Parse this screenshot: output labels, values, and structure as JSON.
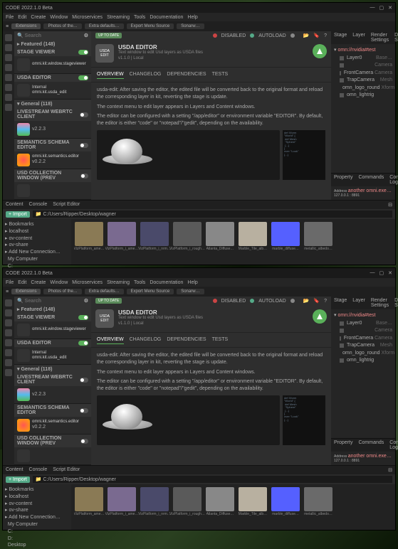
{
  "app_title": "CODE 2022.1.0 Beta",
  "menu": [
    "File",
    "Edit",
    "Create",
    "Window",
    "Microservices",
    "Streaming",
    "Tools",
    "Documentation",
    "Help"
  ],
  "tabs": [
    {
      "label": "Extensions",
      "active": true
    },
    {
      "label": "Photos of the…"
    },
    {
      "label": "Extra defaults…"
    },
    {
      "label": "Export Menu Source"
    },
    {
      "label": "Sonarw…"
    }
  ],
  "sidebar": {
    "search_ph": "Search",
    "featured": "Featured (148)",
    "items": [
      {
        "name": "STAGE VIEWER",
        "desc": "omni.kit.window.stageviewer",
        "ver": "",
        "color": "#333",
        "on": true
      },
      {
        "name": "USDA EDITOR",
        "desc": "Internal\nomni.kit.usda_edit",
        "ver": "",
        "color": "#333",
        "on": true
      },
      {
        "name": "General (118)",
        "desc": "",
        "ver": "",
        "hdr": true
      },
      {
        "name": "LIVESTREAM WEBRTC CLIENT",
        "desc": "",
        "ver": "v2.2.3",
        "color": "linear-gradient(#e8a,#5be,#5b5)",
        "on": false
      },
      {
        "name": "SEMANTICS SCHEMA EDITOR",
        "desc": "omni.kit.semantics.editor",
        "ver": "v0.2.2",
        "color": "radial-gradient(#f55,#fa0)",
        "on": false
      },
      {
        "name": "USD COLLECTION WINDOW (PREV",
        "desc": "",
        "ver": "",
        "color": "#333",
        "on": false
      }
    ]
  },
  "detail": {
    "badge": "UP TO DATE",
    "icon_label": "USDA\nEDIT",
    "title": "USDA EDITOR",
    "subtitle": "Text window to edit Usd layers as USDA files",
    "version": "v1.1.0  |  Local",
    "toolbar": [
      {
        "label": "DISABLED",
        "color": "#c44"
      },
      {
        "label": "AUTOLOAD",
        "color": "#5a8"
      },
      {
        "label": "",
        "color": "#888"
      }
    ],
    "tabs": [
      "OVERVIEW",
      "CHANGELOG",
      "DEPENDENCIES",
      "TESTS"
    ],
    "body": [
      "usda-edit: After saving the editor, the edited file will be converted back to the original format and reload the corresponding layer in kit, reverting the stage is update.",
      "The context menu to edit layer appears in Layers and Content windows.",
      "The editor can be configured with a setting \"/app/editor\" or environment variable \"EDITOR\". By default, the editor is either \"code\" or \"notepad\"/\"gedit\", depending on the availability."
    ]
  },
  "stage": {
    "tabs": [
      "Stage",
      "Layer",
      "Render Settings",
      "Debug Settings"
    ],
    "root": "omn://nvidia#test",
    "items": [
      "Layer0",
      "",
      "FrontCamera",
      "TrapCamera",
      "omn_logo_round",
      "omn_lightrig"
    ],
    "extra": [
      "Base…",
      "Camera",
      "Camera",
      "Mesh",
      "Xform"
    ],
    "props_tabs": [
      "Property",
      "Commands",
      "Console Log"
    ],
    "addr_label": "Address",
    "addr": "127.0.0.1 : 8891",
    "addr_warn": "another omni.exe…"
  },
  "browser": {
    "tabs": [
      "Content",
      "Console",
      "Script Editor"
    ],
    "path": "C:/Users/Ripper/Desktop/wagner",
    "tree": [
      "Bookmarks",
      "localhost",
      "ov-content",
      "ov-share",
      "Add New Connection…",
      "My Computer",
      "C:",
      "D:",
      "Desktop"
    ],
    "thumbs": [
      {
        "label": "VizPlatform_ame…",
        "bg": "#8a7a55"
      },
      {
        "label": "VizPlatform_i_ame…",
        "bg": "#7a6a90"
      },
      {
        "label": "VizPlatform_i_nrm…",
        "bg": "#4a4a6a"
      },
      {
        "label": "VizPlatform_i_rough…",
        "bg": "#5a5a5a"
      },
      {
        "label": "Atlanta_Diffuse…",
        "bg": "#888"
      },
      {
        "label": "Marble_Tile_alb…",
        "bg": "#b8b0a0"
      },
      {
        "label": "marble_diffuse…",
        "bg": "#5560ff"
      },
      {
        "label": "metallic_albedo…",
        "bg": "#6a6a6a"
      }
    ]
  }
}
